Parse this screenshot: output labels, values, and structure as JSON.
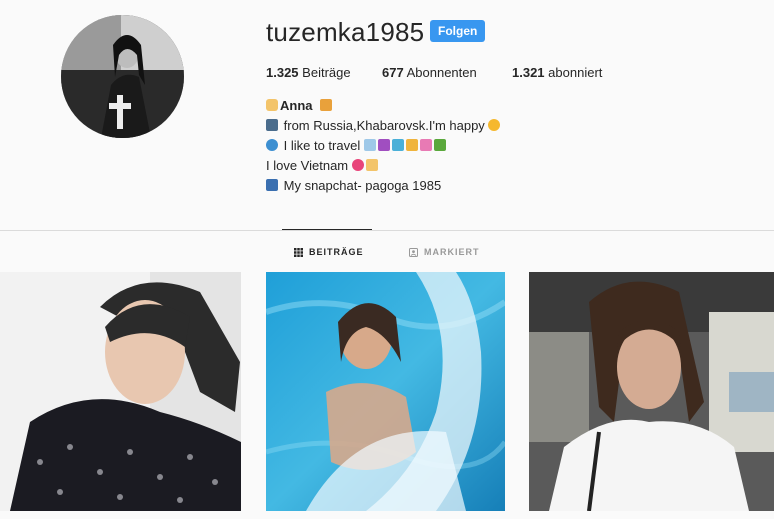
{
  "profile": {
    "username": "tuzemka1985",
    "follow_label": "Folgen",
    "stats": {
      "posts_count": "1.325",
      "posts_label": "Beiträge",
      "followers_count": "677",
      "followers_label": "Abonnenten",
      "following_count": "1.321",
      "following_label": "abonniert"
    },
    "bio": {
      "name": "Anna",
      "line2": "from Russia,Khabarovsk.I'm happy",
      "line3": "I like to travel",
      "line4": "I love Vietnam",
      "line5": "My snapchat- pagoga 1985"
    }
  },
  "tabs": [
    {
      "label": "BEITRÄGE",
      "active": true
    },
    {
      "label": "MARKIERT",
      "active": false
    }
  ],
  "colors": {
    "follow_button": "#3897f0",
    "background": "#fafafa",
    "divider": "#dbdbdb"
  },
  "icons": {
    "grid": "grid-icon",
    "tag": "tag-icon"
  }
}
